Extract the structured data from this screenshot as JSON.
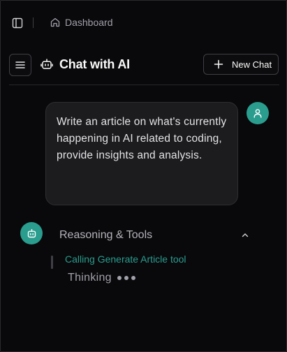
{
  "breadcrumb": {
    "label": "Dashboard"
  },
  "header": {
    "title": "Chat with AI",
    "new_chat_label": "New Chat"
  },
  "messages": {
    "user": {
      "text": "Write an article on what's currently happening in AI related to coding, provide insights and analysis."
    }
  },
  "reasoning": {
    "title": "Reasoning & Tools",
    "tool_status": "Calling Generate Article tool",
    "thinking_label": "Thinking"
  },
  "icons": {
    "sidebar": "sidebar-toggle-icon",
    "home": "home-icon",
    "menu": "menu-icon",
    "bot": "bot-icon",
    "plus": "plus-icon",
    "user": "user-icon",
    "chevron": "chevron-up-icon"
  },
  "colors": {
    "background": "#09090b",
    "accent": "#2a9d8f",
    "bubble": "#1c1c1f",
    "border": "#3f3f46"
  }
}
